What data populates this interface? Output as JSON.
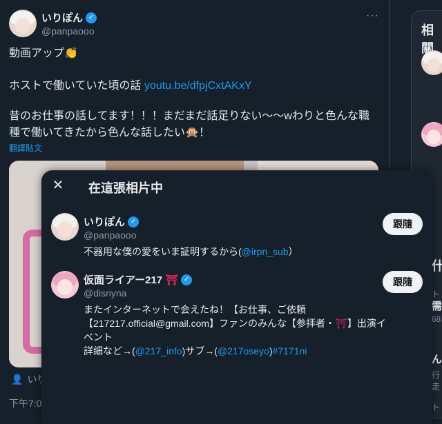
{
  "post": {
    "display_name": "いりぽん",
    "handle": "@panpaooo",
    "more_icon": "more-icon",
    "line1": "動画アップ👏",
    "line2_text": "ホストで働いていた頃の話 ",
    "line2_link": "youtu.be/dfpjCxtAKxY",
    "line3": "昔のお仕事の話してます！！！まだまだ話足りない〜〜wわりと色んな職",
    "line4": "種で働いてきたから色んな話したい🙊！",
    "translate": "翻譯貼文",
    "tag_label": "いり",
    "timestamp": "下午7:0"
  },
  "sidebar": {
    "title": "相關",
    "section2": "什",
    "snip1": "ト",
    "snip2": "需",
    "snip3": "68",
    "snip4": "ん",
    "snip5": "行走",
    "snip6": "ト"
  },
  "modal": {
    "close_icon": "close-icon",
    "title": "在這張相片中",
    "users": [
      {
        "name": "いりぽん",
        "handle": "@panpaooo",
        "bio_text": "不器用な僕の愛をいま証明するから(",
        "bio_link": "@irpn_sub",
        "bio_end": "）",
        "follow": "跟隨"
      },
      {
        "name": "仮面ライアー217",
        "name_emoji": "⛩",
        "handle": "@disnyna",
        "bio_line1": "またインターネットで会えたね！【お仕事、ご依頼",
        "bio_line2a": "【217217.official@gmail.com】ファンのみんな【参拝者・",
        "bio_line2_emoji": "⛩",
        "bio_line2b": "】出演イベント",
        "bio_line3a": "詳細など→(",
        "bio_link1": "@217_info",
        "bio_line3b": ")サブ→(",
        "bio_link2": "@217oseyo",
        "bio_line3c": ")",
        "bio_hashtag": "#7171ni",
        "follow": "跟隨"
      }
    ]
  }
}
